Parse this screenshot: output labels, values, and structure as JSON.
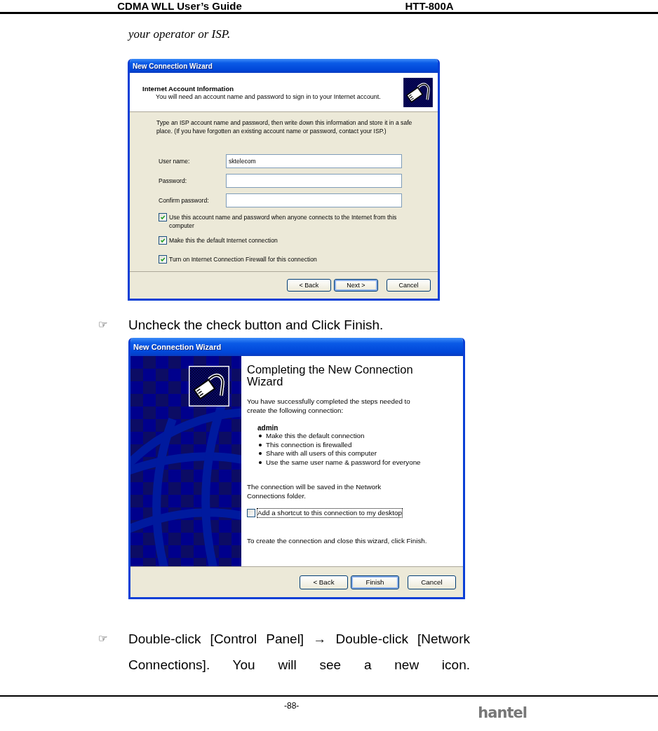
{
  "header": {
    "title": "CDMA WLL User’s Guide",
    "model": "HTT-800A"
  },
  "intro_text": "your operator or ISP.",
  "account_wizard": {
    "title": "New Connection Wizard",
    "heading": "Internet Account Information",
    "subheading": "You will need an account name and password to sign in to your Internet account.",
    "instructions": "Type an ISP account name and password, then write down this information and store it in a safe place. (If you have forgotten an existing account name or password, contact your ISP.)",
    "fields": [
      {
        "label": "User name:",
        "value": "sktelecom"
      },
      {
        "label": "Password:"
      },
      {
        "label": "Confirm password:"
      }
    ],
    "checkboxes": [
      {
        "label": "Use this account  name and password when anyone connects to the Internet from this computer",
        "checked": true,
        "focused": false
      },
      {
        "label": "Make this the default Internet connection",
        "checked": true,
        "focused": false
      },
      {
        "label": "Turn on Internet Connection Firewall for this connection",
        "checked": true,
        "focused": false
      }
    ],
    "buttons": [
      {
        "label": "< Back",
        "default": false
      },
      {
        "label": "Next >",
        "default": true
      },
      {
        "label": "Cancel",
        "default": false
      }
    ]
  },
  "step_1": {
    "marker": "☞",
    "text": "Uncheck the check button and Click Finish."
  },
  "completion_wizard": {
    "title": "New Connection Wizard",
    "heading": "Completing the New Connection Wizard",
    "intro": "You have successfully completed the steps needed to create the following connection:",
    "connection_name": "admin",
    "details": [
      "Make this the default connection",
      "This connection is firewalled",
      "Share with all users of this computer",
      "Use the same user name & password for everyone"
    ],
    "saved_text": "The connection will be saved in the Network Connections folder.",
    "checkboxes": [
      {
        "label": "Add a shortcut to this connection to my desktop",
        "checked": false,
        "focused": true
      }
    ],
    "closing_text": "To create the connection and close this wizard, click Finish.",
    "buttons": [
      {
        "label": "< Back",
        "default": false
      },
      {
        "label": "Finish",
        "default": true
      },
      {
        "label": "Cancel",
        "default": false
      }
    ]
  },
  "step_2": {
    "marker": "☞",
    "text": "Double-click [Control Panel] → Double-click [Network Connections]. You will see a new icon."
  },
  "footer": {
    "page": "-88-",
    "logo": "hantel"
  }
}
